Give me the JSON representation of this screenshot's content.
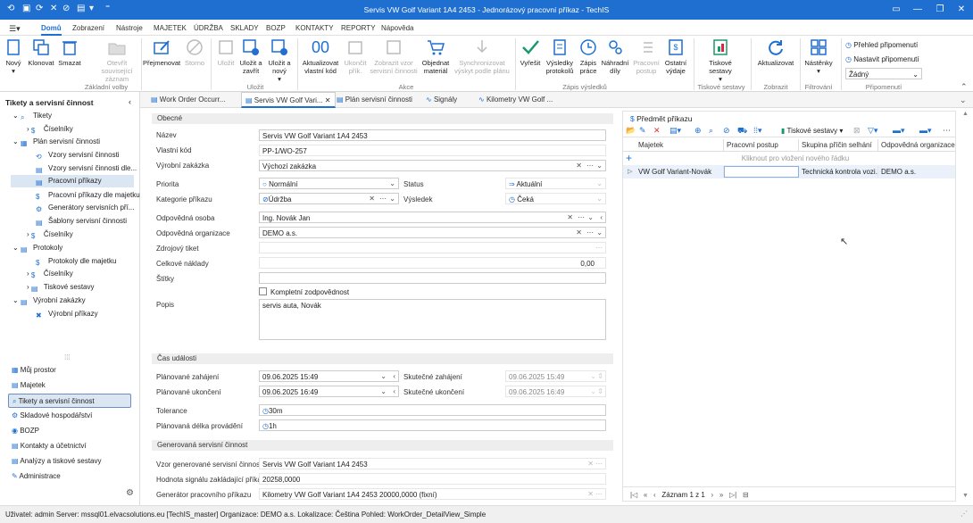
{
  "window": {
    "title": "Servis VW Golf Variant 1A4 2453 - Jednorázový pracovní příkaz - TechIS"
  },
  "menu": [
    "Domů",
    "Zobrazení",
    "Nástroje",
    "MAJETEK",
    "ÚDRŽBA",
    "SKLADY",
    "BOZP",
    "KONTAKTY",
    "REPORTY",
    "Nápověda"
  ],
  "ribbon": {
    "buttons": [
      "Nový",
      "Klonovat",
      "Smazat",
      "Otevřít související záznam",
      "Přejmenovat",
      "Storno",
      "Uložit",
      "Uložit a zavřít",
      "Uložit a nový",
      "Aktualizovat vlastní kód",
      "Ukončit přík.",
      "Zobrazit vzor servisní činnosti",
      "Objednat materiál",
      "Synchronizovat výskyt podle plánu",
      "Vyřešit",
      "Výsledky protokolů",
      "Zápis práce",
      "Náhradní díly",
      "Pracovní postup",
      "Ostatní výdaje",
      "Tiskové sestavy",
      "Aktualizovat",
      "Nástěnky"
    ],
    "groups": [
      "Základní volby",
      "Uložit",
      "Akce",
      "Zápis výsledků",
      "Tiskové sestavy",
      "Zobrazit",
      "Filtrování",
      "Připomenutí"
    ],
    "reminders": {
      "overview": "Přehled připomenutí",
      "set": "Nastavit připomenutí",
      "none": "Žádný"
    }
  },
  "sidebar": {
    "title": "Tikety a servisní činnost",
    "tree": [
      "Tikety",
      "Číselníky",
      "Plán servisní činnosti",
      "Vzory servisní činnosti",
      "Vzory servisní činnosti dle...",
      "Pracovní příkazy",
      "Pracovní příkazy dle majetku",
      "Generátory servisních pří...",
      "Šablony servisní činnosti",
      "Číselníky",
      "Protokoly",
      "Protokoly dle majetku",
      "Číselníky",
      "Tiskové sestavy",
      "Výrobní zakázky",
      "Výrobní příkazy"
    ],
    "nav": [
      "Můj prostor",
      "Majetek",
      "Tikety a servisní činnost",
      "Skladové hospodářství",
      "BOZP",
      "Kontakty a účetnictví",
      "Analýzy a tiskové sestavy",
      "Administrace"
    ]
  },
  "tabs": [
    "Work Order Occurr...",
    "Servis VW Golf Vari...",
    "Plán servisní činnosti",
    "Signály",
    "Kilometry VW Golf ..."
  ],
  "form": {
    "s1": "Obecné",
    "s2": "Čas události",
    "s3": "Generovaná servisní činnost",
    "l": {
      "nazev": "Název",
      "kod": "Vlastní kód",
      "zakazka": "Výrobní zakázka",
      "priorita": "Priorita",
      "status": "Status",
      "kategorie": "Kategorie příkazu",
      "vysledek": "Výsledek",
      "osoba": "Odpovědná osoba",
      "org": "Odpovědná organizace",
      "ticket": "Zdrojový tiket",
      "naklady": "Celkové náklady",
      "stitky": "Štítky",
      "popis": "Popis",
      "pz": "Plánované zahájení",
      "sz": "Skutečné zahájení",
      "pu": "Plánované ukončení",
      "su": "Skutečné ukončení",
      "tol": "Tolerance",
      "pdp": "Plánovaná délka provádění",
      "vzor": "Vzor generované servisní činnosti",
      "sig": "Hodnota signálu zakládající příkaz",
      "gen": "Generátor pracovního příkazu"
    },
    "v": {
      "nazev": "Servis VW Golf Variant 1A4 2453",
      "kod": "PP-1/WO-257",
      "zakazka": "Výchozí zakázka",
      "priorita": "Normální",
      "status": "Aktuální",
      "kategorie": "Údržba",
      "vysledek": "Čeká",
      "osoba": "Ing. Novák Jan",
      "org": "DEMO a.s.",
      "naklady": "0,00",
      "kz": "Kompletní zodpovědnost",
      "popis": "servis auta, Novák",
      "pz": "09.06.2025 15:49",
      "sz": "09.06.2025 15:49",
      "pu": "09.06.2025 16:49",
      "su": "09.06.2025 16:49",
      "tol": "30m",
      "pdp": "1h",
      "vzor": "Servis VW Golf Variant 1A4 2453",
      "sig": "20258,0000",
      "gen": "Kilometry VW Golf Variant 1A4 2453 20000,0000 (fixní)"
    }
  },
  "grid": {
    "title": "Předmět příkazu",
    "report": "Tiskové sestavy",
    "cols": [
      "Majetek",
      "Pracovní postup",
      "Skupina příčin selhání",
      "Odpovědná organizace"
    ],
    "newrow": "Kliknout pro vložení nového řádku",
    "row": [
      "VW Golf Variant-Novák",
      "",
      "Technická kontrola vozi...",
      "DEMO a.s."
    ],
    "pager": "Záznam 1 z 1"
  },
  "status": "Uživatel: admin  Server: mssql01.elvacsolutions.eu [TechIS_master]  Organizace: DEMO a.s.  Lokalizace: Čeština  Pohled: WorkOrder_DetailView_Simple"
}
